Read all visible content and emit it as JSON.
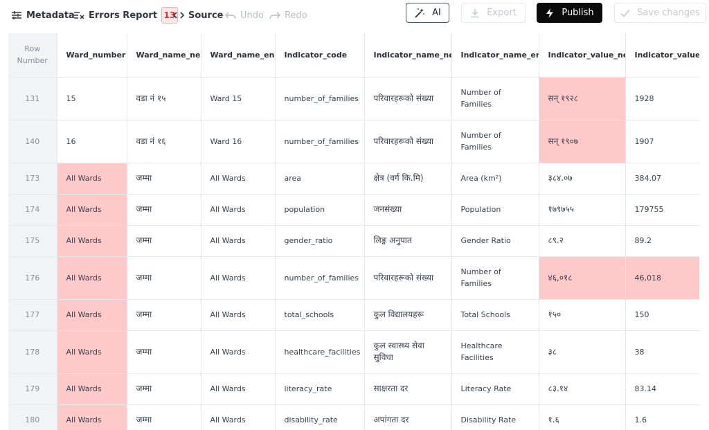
{
  "toolbar": {
    "metadata_label": "Metadata",
    "errors_label": "Errors Report",
    "errors_count": "13",
    "source_label": "Source",
    "undo_label": "Undo",
    "redo_label": "Redo",
    "ai_label": "AI",
    "export_label": "Export",
    "publish_label": "Publish",
    "save_label": "Save changes"
  },
  "colors": {
    "error_cell": "#ffc9c9",
    "row_number_bg": "#f1f3f5",
    "publish_bg": "#0b0b0b",
    "error_badge_text": "#e03131"
  },
  "table": {
    "headers": [
      "Row Number",
      "Ward_number",
      "Ward_name_ne",
      "Ward_name_en",
      "Indicator_code",
      "Indicator_name_ne",
      "Indicator_name_en",
      "Indicator_value_ne",
      "Indicator_value_en"
    ],
    "rows": [
      {
        "cells": [
          "131",
          "15",
          "वडा नं १५",
          "Ward 15",
          "number_of_families",
          "परिवारहरूको संख्या",
          "Number of Families",
          "सन् १९२८",
          "1928"
        ],
        "errors": [
          7
        ],
        "height": "tall"
      },
      {
        "cells": [
          "140",
          "16",
          "वडा नं १६",
          "Ward 16",
          "number_of_families",
          "परिवारहरूको संख्या",
          "Number of Families",
          "सन् १९०७",
          "1907"
        ],
        "errors": [
          7
        ],
        "height": "tall"
      },
      {
        "cells": [
          "173",
          "All Wards",
          "जम्मा",
          "All Wards",
          "area",
          "क्षेत्र (वर्ग कि.मि)",
          "Area (km²)",
          "३८४.०७",
          "384.07"
        ],
        "errors": [
          1
        ],
        "height": "short"
      },
      {
        "cells": [
          "174",
          "All Wards",
          "जम्मा",
          "All Wards",
          "population",
          "जनसंख्या",
          "Population",
          "१७९७५५",
          "179755"
        ],
        "errors": [
          1
        ],
        "height": "short"
      },
      {
        "cells": [
          "175",
          "All Wards",
          "जम्मा",
          "All Wards",
          "gender_ratio",
          "लिङ्ग अनुपात",
          "Gender Ratio",
          "८९.२",
          "89.2"
        ],
        "errors": [
          1
        ],
        "height": "short"
      },
      {
        "cells": [
          "176",
          "All Wards",
          "जम्मा",
          "All Wards",
          "number_of_families",
          "परिवारहरूको संख्या",
          "Number of Families",
          "४६,०१८",
          "46,018"
        ],
        "errors": [
          1,
          7,
          8
        ],
        "height": "tall"
      },
      {
        "cells": [
          "177",
          "All Wards",
          "जम्मा",
          "All Wards",
          "total_schools",
          "कुल विद्यालयहरू",
          "Total Schools",
          "१५०",
          "150"
        ],
        "errors": [
          1
        ],
        "height": "short"
      },
      {
        "cells": [
          "178",
          "All Wards",
          "जम्मा",
          "All Wards",
          "healthcare_facilities",
          "कुल स्वास्थ्य सेवा सुविधा",
          "Healthcare Facilities",
          "३८",
          "38"
        ],
        "errors": [
          1
        ],
        "height": "tall"
      },
      {
        "cells": [
          "179",
          "All Wards",
          "जम्मा",
          "All Wards",
          "literacy_rate",
          "साक्षरता दर",
          "Literacy Rate",
          "८३.१४",
          "83.14"
        ],
        "errors": [
          1
        ],
        "height": "short"
      },
      {
        "cells": [
          "180",
          "All Wards",
          "जम्मा",
          "All Wards",
          "disability_rate",
          "अपांगता दर",
          "Disability Rate",
          "१.६",
          "1.6"
        ],
        "errors": [
          1
        ],
        "height": "short"
      }
    ]
  }
}
